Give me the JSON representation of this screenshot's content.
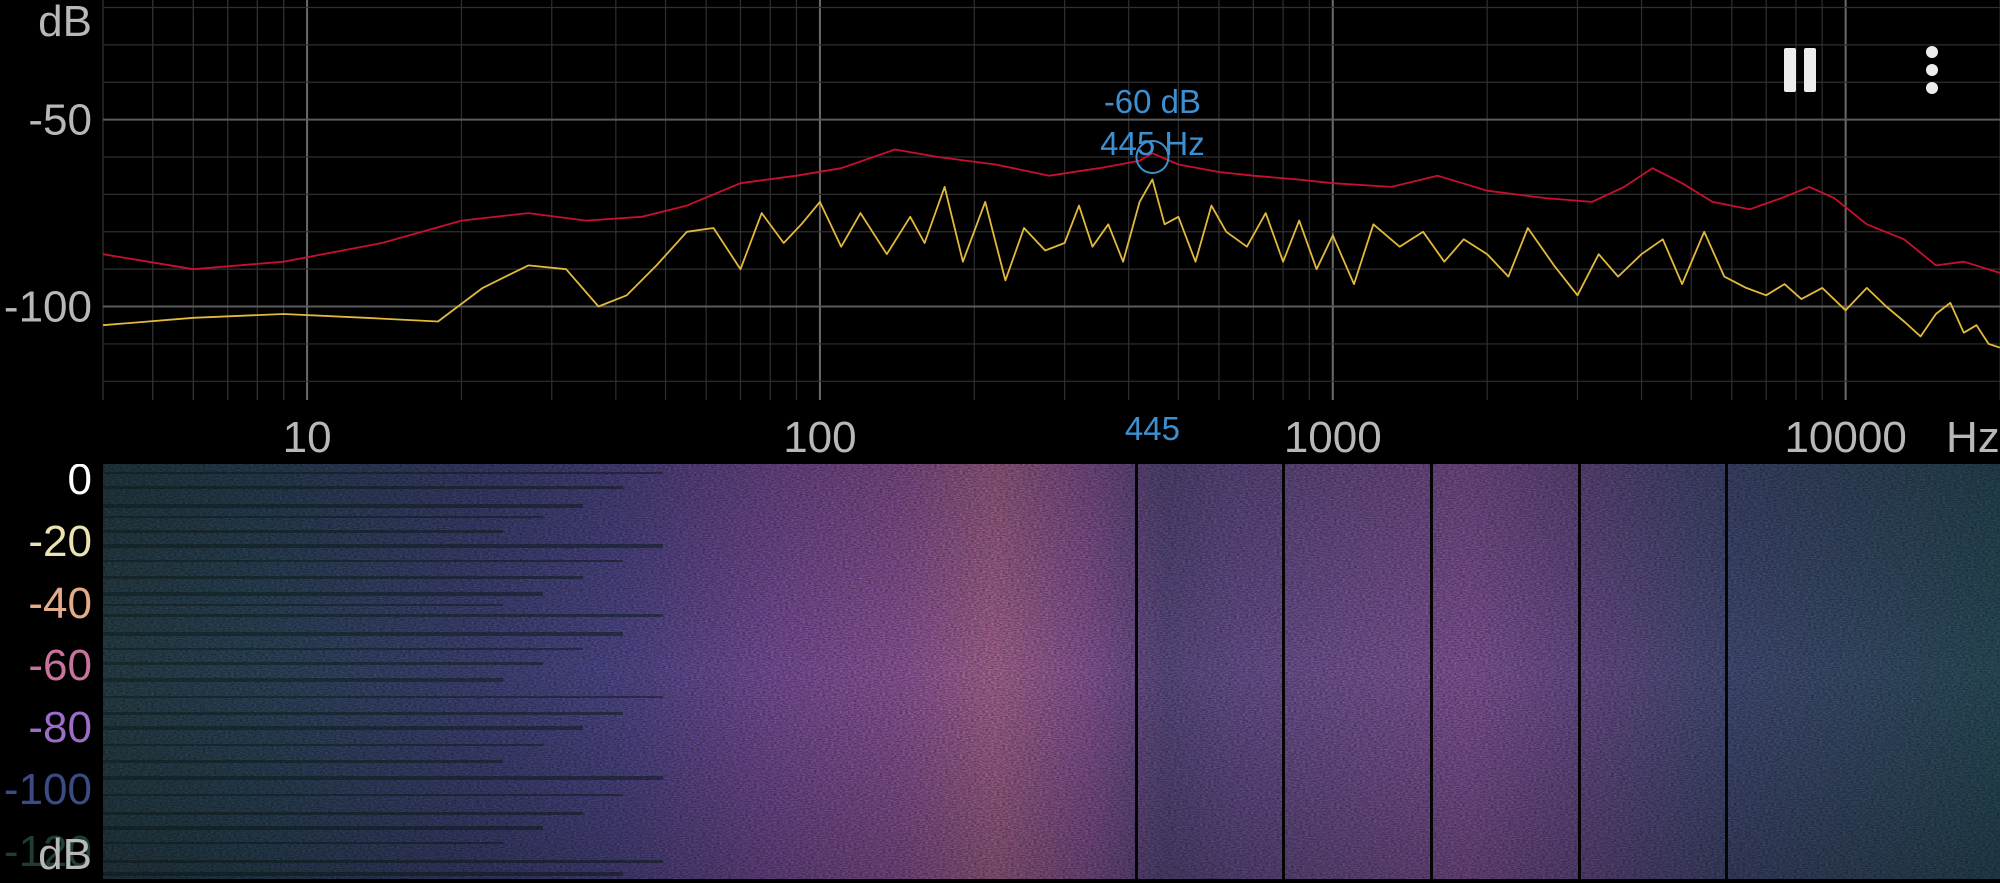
{
  "controls": {
    "pause_icon": "pause-icon",
    "menu_icon": "more-vertical-icon"
  },
  "marker": {
    "freq_hz": 445,
    "db": -60,
    "db_label": "-60 dB",
    "freq_label": "445 Hz",
    "axis_label": "445",
    "color": "#3d8fd0"
  },
  "chart_data": [
    {
      "type": "line",
      "x_scale": "log",
      "xlim": [
        4,
        20000
      ],
      "ylim": [
        -125,
        -18
      ],
      "ylabel": "dB",
      "xunit": "Hz",
      "x_ticks": [
        10,
        100,
        1000,
        10000
      ],
      "x_tick_labels": [
        "10",
        "100",
        "1000",
        "10000"
      ],
      "y_ticks": [
        -50,
        -100
      ],
      "y_tick_labels": [
        "-50",
        "-100"
      ],
      "grid": true,
      "series": [
        {
          "color": "#c8102e",
          "x": [
            4,
            6,
            9,
            14,
            20,
            27,
            35,
            45,
            55,
            70,
            90,
            110,
            140,
            170,
            220,
            280,
            350,
            420,
            445,
            500,
            600,
            700,
            850,
            1000,
            1300,
            1600,
            2000,
            2600,
            3200,
            3700,
            4200,
            4800,
            5500,
            6500,
            7500,
            8500,
            9500,
            11000,
            13000,
            15000,
            17000,
            20000
          ],
          "y": [
            -86,
            -90,
            -88,
            -83,
            -77,
            -75,
            -77,
            -76,
            -73,
            -67,
            -65,
            -63,
            -58,
            -60,
            -62,
            -65,
            -63,
            -61,
            -59,
            -62,
            -64,
            -65,
            -66,
            -67,
            -68,
            -65,
            -69,
            -71,
            -72,
            -68,
            -63,
            -67,
            -72,
            -74,
            -71,
            -68,
            -71,
            -78,
            -82,
            -89,
            -88,
            -91
          ]
        },
        {
          "color": "#e2b93b",
          "x": [
            4,
            6,
            9,
            13,
            18,
            22,
            27,
            32,
            37,
            42,
            48,
            55,
            62,
            70,
            77,
            85,
            92,
            100,
            110,
            120,
            135,
            150,
            160,
            175,
            190,
            210,
            230,
            250,
            275,
            300,
            320,
            340,
            365,
            390,
            420,
            445,
            470,
            500,
            540,
            580,
            620,
            680,
            740,
            800,
            860,
            930,
            1000,
            1100,
            1200,
            1350,
            1500,
            1650,
            1800,
            2000,
            2200,
            2400,
            2700,
            3000,
            3300,
            3600,
            4000,
            4400,
            4800,
            5300,
            5800,
            6400,
            7000,
            7600,
            8200,
            9000,
            10000,
            11000,
            12000,
            13000,
            14000,
            15000,
            16000,
            17000,
            18000,
            19000,
            20000
          ],
          "y": [
            -105,
            -103,
            -102,
            -103,
            -104,
            -95,
            -89,
            -90,
            -100,
            -97,
            -89,
            -80,
            -79,
            -90,
            -75,
            -83,
            -78,
            -72,
            -84,
            -75,
            -86,
            -76,
            -83,
            -68,
            -88,
            -72,
            -93,
            -79,
            -85,
            -83,
            -73,
            -84,
            -78,
            -88,
            -72,
            -66,
            -78,
            -76,
            -88,
            -73,
            -80,
            -84,
            -75,
            -88,
            -77,
            -90,
            -81,
            -94,
            -78,
            -84,
            -80,
            -88,
            -82,
            -86,
            -92,
            -79,
            -89,
            -97,
            -86,
            -92,
            -86,
            -82,
            -94,
            -80,
            -92,
            -95,
            -97,
            -94,
            -98,
            -95,
            -101,
            -95,
            -100,
            -104,
            -108,
            -102,
            -99,
            -107,
            -105,
            -110,
            -111
          ]
        }
      ]
    },
    {
      "type": "heatmap",
      "x_scale": "log",
      "xlim": [
        4,
        20000
      ],
      "ylabel": "dB",
      "colorbar_ticks": [
        "0",
        "-20",
        "-40",
        "-60",
        "-80",
        "-100",
        "-120"
      ],
      "colorbar_colors": [
        "#ffffff",
        "#ebe3b4",
        "#e3ab8a",
        "#c8739c",
        "#9b6cc8",
        "#3c4b86",
        "#1f3d35"
      ]
    }
  ]
}
